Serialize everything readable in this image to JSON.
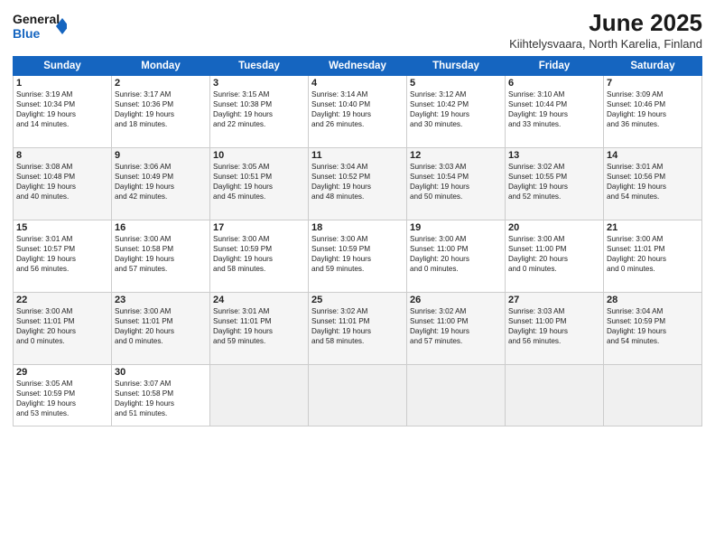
{
  "header": {
    "logo_line1": "General",
    "logo_line2": "Blue",
    "month": "June 2025",
    "location": "Kiihtelysvaara, North Karelia, Finland"
  },
  "weekdays": [
    "Sunday",
    "Monday",
    "Tuesday",
    "Wednesday",
    "Thursday",
    "Friday",
    "Saturday"
  ],
  "weeks": [
    [
      {
        "day": "1",
        "info": "Sunrise: 3:19 AM\nSunset: 10:34 PM\nDaylight: 19 hours\nand 14 minutes."
      },
      {
        "day": "2",
        "info": "Sunrise: 3:17 AM\nSunset: 10:36 PM\nDaylight: 19 hours\nand 18 minutes."
      },
      {
        "day": "3",
        "info": "Sunrise: 3:15 AM\nSunset: 10:38 PM\nDaylight: 19 hours\nand 22 minutes."
      },
      {
        "day": "4",
        "info": "Sunrise: 3:14 AM\nSunset: 10:40 PM\nDaylight: 19 hours\nand 26 minutes."
      },
      {
        "day": "5",
        "info": "Sunrise: 3:12 AM\nSunset: 10:42 PM\nDaylight: 19 hours\nand 30 minutes."
      },
      {
        "day": "6",
        "info": "Sunrise: 3:10 AM\nSunset: 10:44 PM\nDaylight: 19 hours\nand 33 minutes."
      },
      {
        "day": "7",
        "info": "Sunrise: 3:09 AM\nSunset: 10:46 PM\nDaylight: 19 hours\nand 36 minutes."
      }
    ],
    [
      {
        "day": "8",
        "info": "Sunrise: 3:08 AM\nSunset: 10:48 PM\nDaylight: 19 hours\nand 40 minutes."
      },
      {
        "day": "9",
        "info": "Sunrise: 3:06 AM\nSunset: 10:49 PM\nDaylight: 19 hours\nand 42 minutes."
      },
      {
        "day": "10",
        "info": "Sunrise: 3:05 AM\nSunset: 10:51 PM\nDaylight: 19 hours\nand 45 minutes."
      },
      {
        "day": "11",
        "info": "Sunrise: 3:04 AM\nSunset: 10:52 PM\nDaylight: 19 hours\nand 48 minutes."
      },
      {
        "day": "12",
        "info": "Sunrise: 3:03 AM\nSunset: 10:54 PM\nDaylight: 19 hours\nand 50 minutes."
      },
      {
        "day": "13",
        "info": "Sunrise: 3:02 AM\nSunset: 10:55 PM\nDaylight: 19 hours\nand 52 minutes."
      },
      {
        "day": "14",
        "info": "Sunrise: 3:01 AM\nSunset: 10:56 PM\nDaylight: 19 hours\nand 54 minutes."
      }
    ],
    [
      {
        "day": "15",
        "info": "Sunrise: 3:01 AM\nSunset: 10:57 PM\nDaylight: 19 hours\nand 56 minutes."
      },
      {
        "day": "16",
        "info": "Sunrise: 3:00 AM\nSunset: 10:58 PM\nDaylight: 19 hours\nand 57 minutes."
      },
      {
        "day": "17",
        "info": "Sunrise: 3:00 AM\nSunset: 10:59 PM\nDaylight: 19 hours\nand 58 minutes."
      },
      {
        "day": "18",
        "info": "Sunrise: 3:00 AM\nSunset: 10:59 PM\nDaylight: 19 hours\nand 59 minutes."
      },
      {
        "day": "19",
        "info": "Sunrise: 3:00 AM\nSunset: 11:00 PM\nDaylight: 20 hours\nand 0 minutes."
      },
      {
        "day": "20",
        "info": "Sunrise: 3:00 AM\nSunset: 11:00 PM\nDaylight: 20 hours\nand 0 minutes."
      },
      {
        "day": "21",
        "info": "Sunrise: 3:00 AM\nSunset: 11:01 PM\nDaylight: 20 hours\nand 0 minutes."
      }
    ],
    [
      {
        "day": "22",
        "info": "Sunrise: 3:00 AM\nSunset: 11:01 PM\nDaylight: 20 hours\nand 0 minutes."
      },
      {
        "day": "23",
        "info": "Sunrise: 3:00 AM\nSunset: 11:01 PM\nDaylight: 20 hours\nand 0 minutes."
      },
      {
        "day": "24",
        "info": "Sunrise: 3:01 AM\nSunset: 11:01 PM\nDaylight: 19 hours\nand 59 minutes."
      },
      {
        "day": "25",
        "info": "Sunrise: 3:02 AM\nSunset: 11:01 PM\nDaylight: 19 hours\nand 58 minutes."
      },
      {
        "day": "26",
        "info": "Sunrise: 3:02 AM\nSunset: 11:00 PM\nDaylight: 19 hours\nand 57 minutes."
      },
      {
        "day": "27",
        "info": "Sunrise: 3:03 AM\nSunset: 11:00 PM\nDaylight: 19 hours\nand 56 minutes."
      },
      {
        "day": "28",
        "info": "Sunrise: 3:04 AM\nSunset: 10:59 PM\nDaylight: 19 hours\nand 54 minutes."
      }
    ],
    [
      {
        "day": "29",
        "info": "Sunrise: 3:05 AM\nSunset: 10:59 PM\nDaylight: 19 hours\nand 53 minutes."
      },
      {
        "day": "30",
        "info": "Sunrise: 3:07 AM\nSunset: 10:58 PM\nDaylight: 19 hours\nand 51 minutes."
      },
      null,
      null,
      null,
      null,
      null
    ]
  ]
}
